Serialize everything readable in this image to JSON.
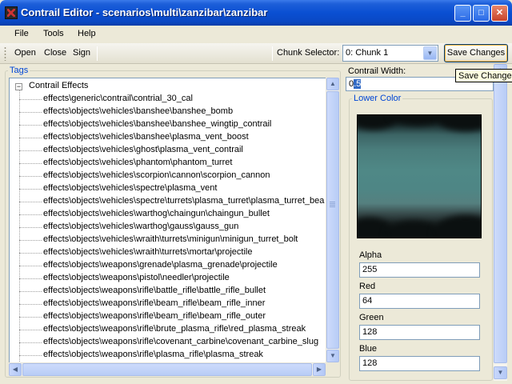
{
  "window": {
    "title": "Contrail Editor - scenarios\\multi\\zanzibar\\zanzibar",
    "minimize_glyph": "_",
    "maximize_glyph": "□",
    "close_glyph": "✕"
  },
  "menu": {
    "items": [
      "File",
      "Tools",
      "Help"
    ]
  },
  "toolbar": {
    "open_label": "Open",
    "close_label": "Close",
    "sign_label": "Sign",
    "chunk_selector_label": "Chunk Selector:",
    "chunk_selected": "0: Chunk 1",
    "save_label": "Save Changes",
    "save_tooltip": "Save Changes"
  },
  "tags": {
    "group_label": "Tags",
    "root_label": "Contrail Effects",
    "items": [
      "effects\\generic\\contrail\\contrial_30_cal",
      "effects\\objects\\vehicles\\banshee\\banshee_bomb",
      "effects\\objects\\vehicles\\banshee\\banshee_wingtip_contrail",
      "effects\\objects\\vehicles\\banshee\\plasma_vent_boost",
      "effects\\objects\\vehicles\\ghost\\plasma_vent_contrail",
      "effects\\objects\\vehicles\\phantom\\phantom_turret",
      "effects\\objects\\vehicles\\scorpion\\cannon\\scorpion_cannon",
      "effects\\objects\\vehicles\\spectre\\plasma_vent",
      "effects\\objects\\vehicles\\spectre\\turrets\\plasma_turret\\plasma_turret_bea",
      "effects\\objects\\vehicles\\warthog\\chaingun\\chaingun_bullet",
      "effects\\objects\\vehicles\\warthog\\gauss\\gauss_gun",
      "effects\\objects\\vehicles\\wraith\\turrets\\minigun\\minigun_turret_bolt",
      "effects\\objects\\vehicles\\wraith\\turrets\\mortar\\projectile",
      "effects\\objects\\weapons\\grenade\\plasma_grenade\\projectile",
      "effects\\objects\\weapons\\pistol\\needler\\projectile",
      "effects\\objects\\weapons\\rifle\\battle_rifle\\battle_rifle_bullet",
      "effects\\objects\\weapons\\rifle\\beam_rifle\\beam_rifle_inner",
      "effects\\objects\\weapons\\rifle\\beam_rifle\\beam_rifle_outer",
      "effects\\objects\\weapons\\rifle\\brute_plasma_rifle\\red_plasma_streak",
      "effects\\objects\\weapons\\rifle\\covenant_carbine\\covenant_carbine_slug",
      "effects\\objects\\weapons\\rifle\\plasma_rifle\\plasma_streak"
    ]
  },
  "properties": {
    "contrail_width_label": "Contrail Width:",
    "contrail_width_prefix": "0",
    "contrail_width_selected": ".5",
    "lower_color_label": "Lower Color",
    "alpha_label": "Alpha",
    "alpha_value": "255",
    "red_label": "Red",
    "red_value": "64",
    "green_label": "Green",
    "green_value": "128",
    "blue_label": "Blue",
    "blue_value": "128"
  },
  "colors": {
    "titlebar": "#0a4fd2",
    "legend_text": "#0046d5",
    "lower_color_preview": "#408080"
  },
  "icons": {
    "app": "app-icon",
    "tree_expander": "minus-box-icon",
    "combo": "chevron-down-icon",
    "scroll_up": "scroll-up-arrow-icon",
    "scroll_down": "scroll-down-arrow-icon",
    "scroll_left": "scroll-left-arrow-icon",
    "scroll_right": "scroll-right-arrow-icon"
  }
}
